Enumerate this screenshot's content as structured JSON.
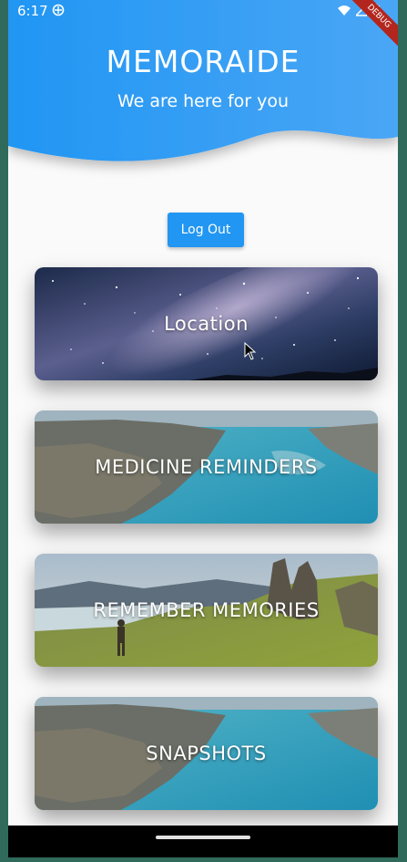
{
  "status_bar": {
    "time": "6:17",
    "debug_label": "DEBUG"
  },
  "header": {
    "title": "MEMORAIDE",
    "subtitle": "We are here for you"
  },
  "logout_label": "Log Out",
  "cards": [
    {
      "label": "Location",
      "image": "starry-sky"
    },
    {
      "label": "MEDICINE REMINDERS",
      "image": "coastline-aerial"
    },
    {
      "label": "REMEMBER MEMORIES",
      "image": "mountain-hiker"
    },
    {
      "label": "SNAPSHOTS",
      "image": "coastline-aerial"
    }
  ],
  "colors": {
    "header_blue": "#2196f3",
    "button_blue": "#2196f3",
    "frame": "#2f6a5b"
  }
}
